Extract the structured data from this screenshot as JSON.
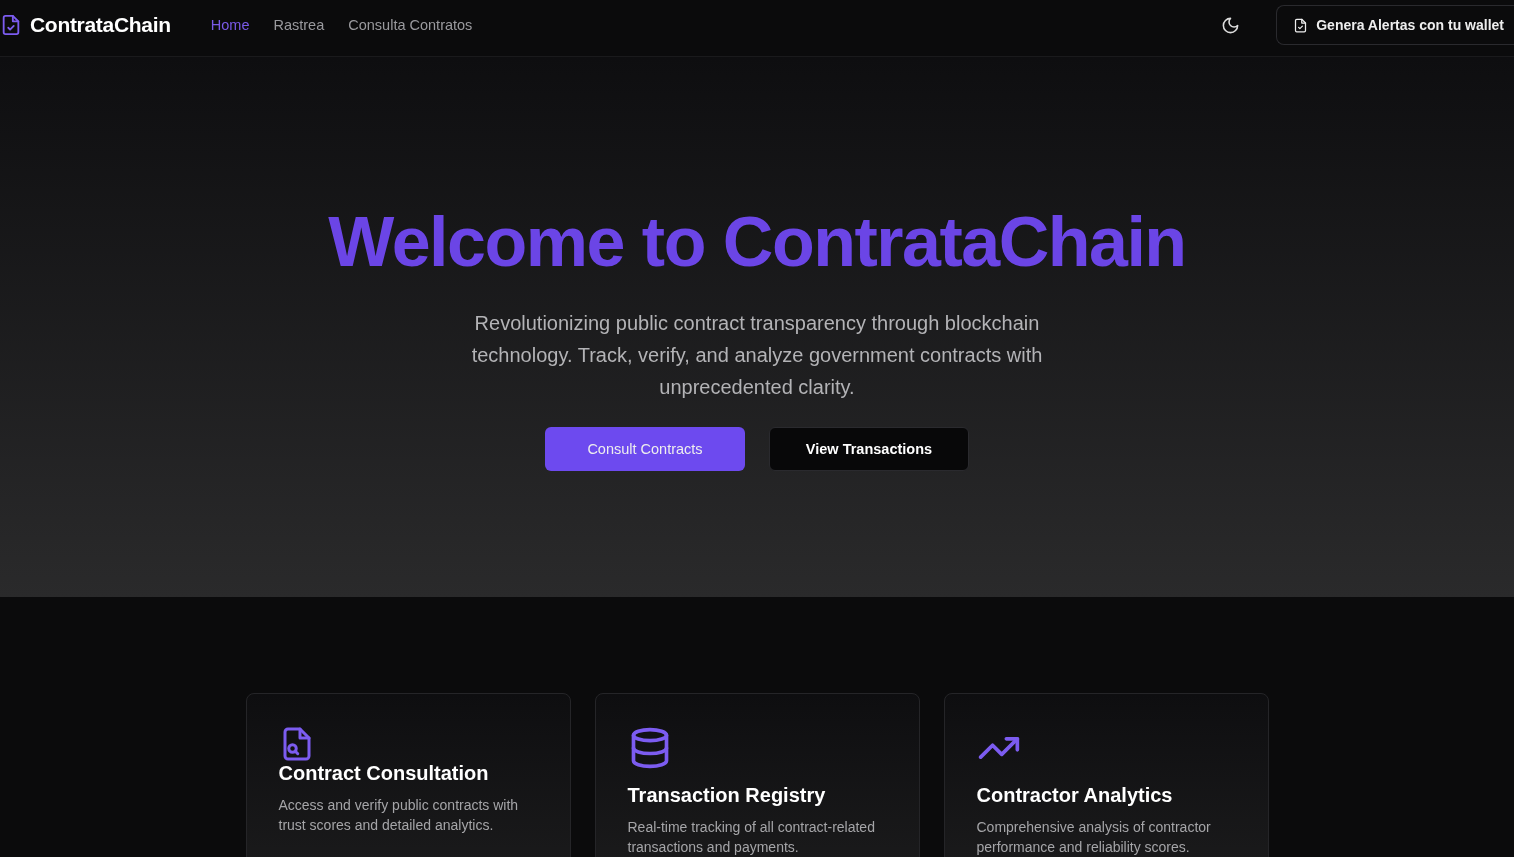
{
  "header": {
    "brand": "ContrataChain",
    "nav": [
      {
        "label": "Home",
        "selected": true
      },
      {
        "label": "Rastrea",
        "selected": false
      },
      {
        "label": "Consulta Contratos",
        "selected": false
      }
    ],
    "wallet_button": "Genera Alertas con tu wallet"
  },
  "hero": {
    "title": "Welcome to ContrataChain",
    "subtitle": "Revolutionizing public contract transparency through blockchain technology. Track, verify, and analyze government contracts with unprecedented clarity.",
    "buttons": [
      {
        "label": "Consult Contracts",
        "kind": "primary"
      },
      {
        "label": "View Transactions",
        "kind": "secondary"
      }
    ]
  },
  "features": [
    {
      "kind": "file-search",
      "title": "Contract Consultation",
      "text": "Access and verify public contracts with trust scores and detailed analytics."
    },
    {
      "kind": "database",
      "title": "Transaction Registry",
      "text": "Real-time tracking of all contract-related transactions and payments."
    },
    {
      "kind": "trend",
      "title": "Contractor Analytics",
      "text": "Comprehensive analysis of contractor performance and reliability scores."
    }
  ]
}
